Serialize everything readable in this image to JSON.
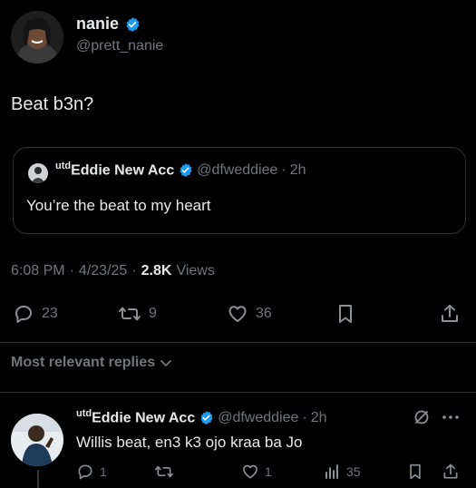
{
  "post": {
    "author_name": "nanie",
    "author_handle": "@prett_nanie",
    "text": "Beat b3n?",
    "quoted": {
      "author_prefix": "utd",
      "author_name": "Eddie New Acc",
      "author_handle": "@dfweddiee",
      "time": "2h",
      "text": "You’re the beat to my heart"
    },
    "meta": {
      "time": "6:08 PM",
      "date": "4/23/25",
      "views_count": "2.8K",
      "views_label": "Views",
      "separator": "·"
    },
    "actions": {
      "replies": "23",
      "reposts": "9",
      "likes": "36"
    }
  },
  "replies_filter": {
    "label": "Most relevant replies"
  },
  "reply": {
    "author_prefix": "utd",
    "author_name": "Eddie New Acc",
    "author_handle": "@dfweddiee",
    "time": "2h",
    "text": "Willis beat, en3 k3 ojo kraa ba Jo",
    "actions": {
      "replies": "1",
      "likes": "1",
      "views": "35"
    }
  },
  "colors": {
    "background": "#000000",
    "text": "#e7e9ea",
    "muted": "#71767b",
    "verified": "#1d9bf0",
    "border": "#2f3336"
  }
}
